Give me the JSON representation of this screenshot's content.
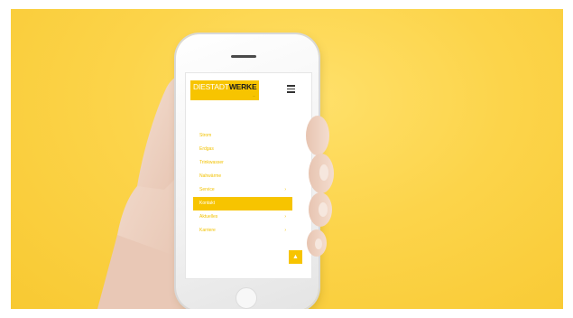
{
  "colors": {
    "background": "#fcd44a",
    "brand_yellow": "#f7c400",
    "phone_body": "#f3f3f3"
  },
  "logo": {
    "prefix": "DIE",
    "name_light": "STADT",
    "name_bold": "WERKE",
    "subline": "..."
  },
  "header": {
    "menu_icon": "hamburger-icon"
  },
  "nav": {
    "items": [
      {
        "label": "Strom"
      },
      {
        "label": "Erdgas"
      },
      {
        "label": "Trinkwasser"
      },
      {
        "label": "Nahwärme"
      },
      {
        "label": "Service",
        "chevron": "›"
      },
      {
        "label": "Kontakt"
      },
      {
        "label": "Aktuelles",
        "chevron": "›"
      },
      {
        "label": "Karriere",
        "chevron": "›"
      }
    ],
    "active_index": 5
  },
  "up_button": {
    "icon": "arrow-up-icon",
    "glyph": "▲"
  }
}
